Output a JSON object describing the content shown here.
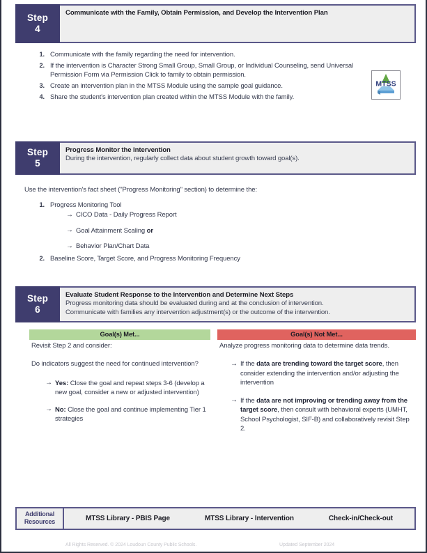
{
  "colors": {
    "step_tab": "#3f3d6e",
    "step_head_bg": "#eeeeee",
    "step_head_border": "#5a5889",
    "goal_met": "#b3d79b",
    "goal_not_met": "#e0635f",
    "text": "#33384b",
    "footer_text": "#c6c6cc"
  },
  "steps": [
    {
      "tab_word": "Step",
      "tab_number": "4",
      "title": "Communicate with the Family, Obtain Permission, and Develop the Intervention Plan",
      "subtitle": "",
      "items": [
        {
          "num": "1.",
          "text": "Communicate with the family regarding the need for intervention."
        },
        {
          "num": "2.",
          "text": "If the intervention is Character Strong Small Group, Small Group, or Individual Counseling, send Universal Permission Form via Permission Click to family to obtain permission."
        },
        {
          "num": "3.",
          "text": "Create an intervention plan in the MTSS Module using the sample goal guidance."
        },
        {
          "num": "4.",
          "text": "Share the student's intervention plan created within the MTSS Module with the family."
        }
      ],
      "logo": {
        "name": "mtss-logo",
        "label": "MTSS"
      }
    },
    {
      "tab_word": "Step",
      "tab_number": "5",
      "title": "Progress Monitor the Intervention",
      "subtitle": "During the intervention, regularly collect data about student growth toward goal(s).",
      "intro": "Use the intervention's fact sheet (\"Progress Monitoring\" section) to determine the:",
      "items": [
        {
          "num": "1.",
          "text": "Progress Monitoring Tool"
        },
        {
          "num": "2.",
          "text": "Baseline Score, Target Score, and Progress Monitoring Frequency"
        }
      ],
      "sub_arrows": [
        {
          "text": "CICO Data - Daily Progress Report",
          "bold_suffix": ""
        },
        {
          "text": "Goal Attainment Scaling ",
          "bold_suffix": "or"
        },
        {
          "text": "Behavior Plan/Chart Data",
          "bold_suffix": ""
        }
      ]
    },
    {
      "tab_word": "Step",
      "tab_number": "6",
      "title": "Evaluate Student Response to the Intervention and Determine Next Steps",
      "subtitle_line1": "Progress monitoring data should be evaluated during and at the conclusion of intervention.",
      "subtitle_line2": "Communicate with families any intervention adjustment(s) or the outcome of the intervention.",
      "columns": [
        {
          "banner": "Goal(s) Met...",
          "banner_color": "green",
          "intro": "Revisit Step 2 and consider:",
          "question": "Do indicators suggest the need for continued intervention?",
          "bullets": [
            {
              "lead": "Yes:",
              "text": " Close the goal and repeat steps 3-6 (develop a new goal, consider a new or adjusted intervention)"
            },
            {
              "lead": "No:",
              "text": " Close the goal and continue implementing Tier 1 strategies"
            }
          ]
        },
        {
          "banner": "Goal(s) Not Met...",
          "banner_color": "red",
          "intro": "Analyze progress monitoring data to determine data trends.",
          "question": "",
          "bullets": [
            {
              "pre": "If the ",
              "lead": "data are trending toward the target score",
              "text": ", then consider extending the intervention and/or adjusting the intervention"
            },
            {
              "pre": "If the ",
              "lead": "data are not improving or trending away from the target score",
              "text": ", then consult with behavioral experts (UMHT, School Psychologist, SIF-B) and collaboratively revisit Step 2."
            }
          ]
        }
      ]
    }
  ],
  "resources": {
    "label_line1": "Additional",
    "label_line2": "Resources",
    "links": [
      "MTSS Library - PBIS Page",
      "MTSS Library - Intervention",
      "Check-in/Check-out"
    ]
  },
  "footer": {
    "copyright": "All Rights Reserved. © 2024 Loudoun County Public Schools.",
    "updated": "Updated September 2024"
  }
}
